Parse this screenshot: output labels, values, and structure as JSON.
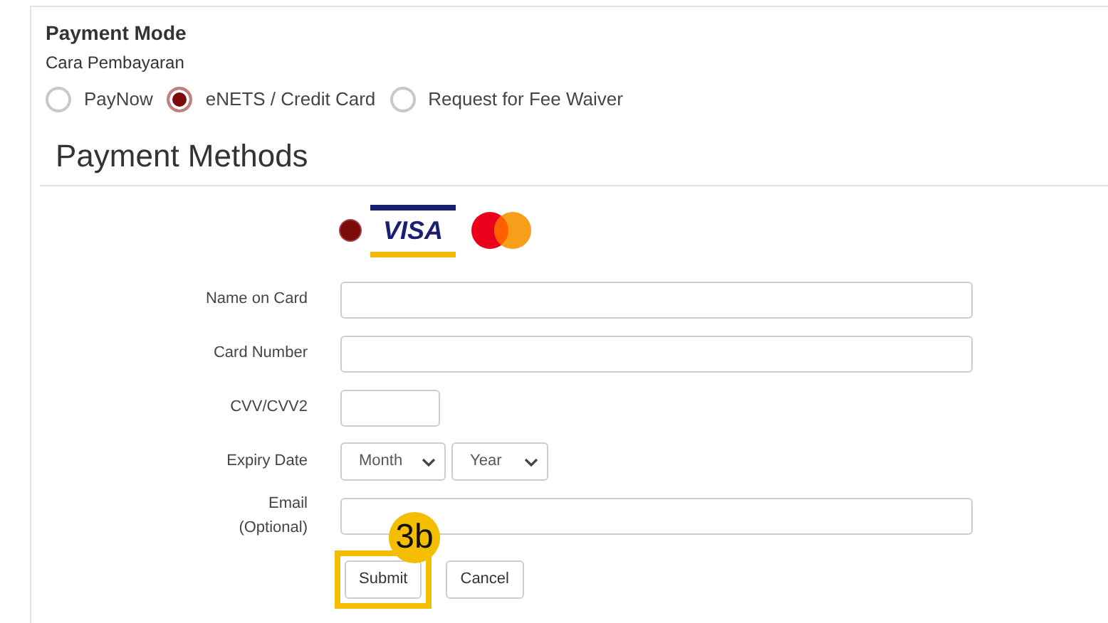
{
  "payment_mode": {
    "title": "Payment Mode",
    "subtitle": "Cara Pembayaran",
    "options": [
      {
        "label": "PayNow",
        "selected": false
      },
      {
        "label": "eNETS / Credit Card",
        "selected": true
      },
      {
        "label": "Request for Fee Waiver",
        "selected": false
      }
    ]
  },
  "payment_methods": {
    "title": "Payment Methods",
    "card_selected": true,
    "visa_logo": "VISA",
    "fields": [
      {
        "kind": "text",
        "label": "Name on Card"
      },
      {
        "kind": "text",
        "label": "Card Number"
      },
      {
        "kind": "short_text",
        "label": "CVV/CVV2"
      },
      {
        "kind": "selects",
        "label": "Expiry Date",
        "selects": [
          "Month",
          "Year"
        ]
      },
      {
        "kind": "text",
        "label": "Email\n(Optional)"
      }
    ],
    "buttons": [
      {
        "label": "Submit",
        "highlighted": true
      },
      {
        "label": "Cancel",
        "highlighted": false
      }
    ]
  },
  "annotation": {
    "label": "3b"
  }
}
